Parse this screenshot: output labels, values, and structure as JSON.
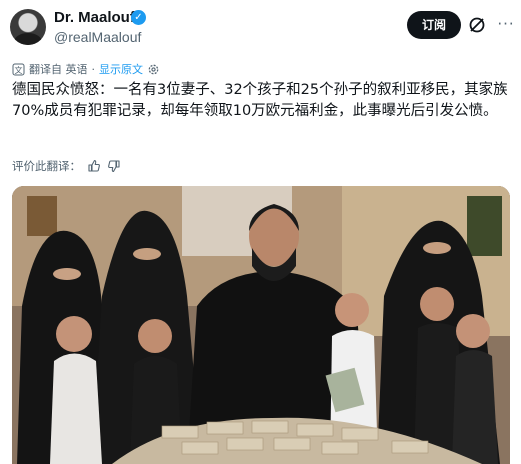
{
  "author": {
    "name": "Dr. Maalouf",
    "handle": "@realMaalouf",
    "verified_icon": "verified-badge-icon"
  },
  "actions": {
    "subscribe_label": "订阅",
    "grok_icon": "grok-icon",
    "more_icon": "more-options-icon"
  },
  "translation": {
    "translated_from": "翻译自 英语",
    "show_original": "显示原文",
    "settings_icon": "gear-icon"
  },
  "post": {
    "text": "德国民众愤怒：一名有3位妻子、32个孩子和25个孙子的叙利亚移民，其家族70%成员有犯罪记录，却每年领取10万欧元福利金，此事曝光后引发公愤。"
  },
  "rating": {
    "label": "评价此翻译：",
    "thumbs_up_icon": "thumbs-up-icon",
    "thumbs_down_icon": "thumbs-down-icon"
  },
  "media": {
    "image_icon": "family-photo-image"
  },
  "colors": {
    "accent": "#1d9bf0",
    "text": "#0f1419",
    "secondary_text": "#536471",
    "button": "#0f1419"
  }
}
